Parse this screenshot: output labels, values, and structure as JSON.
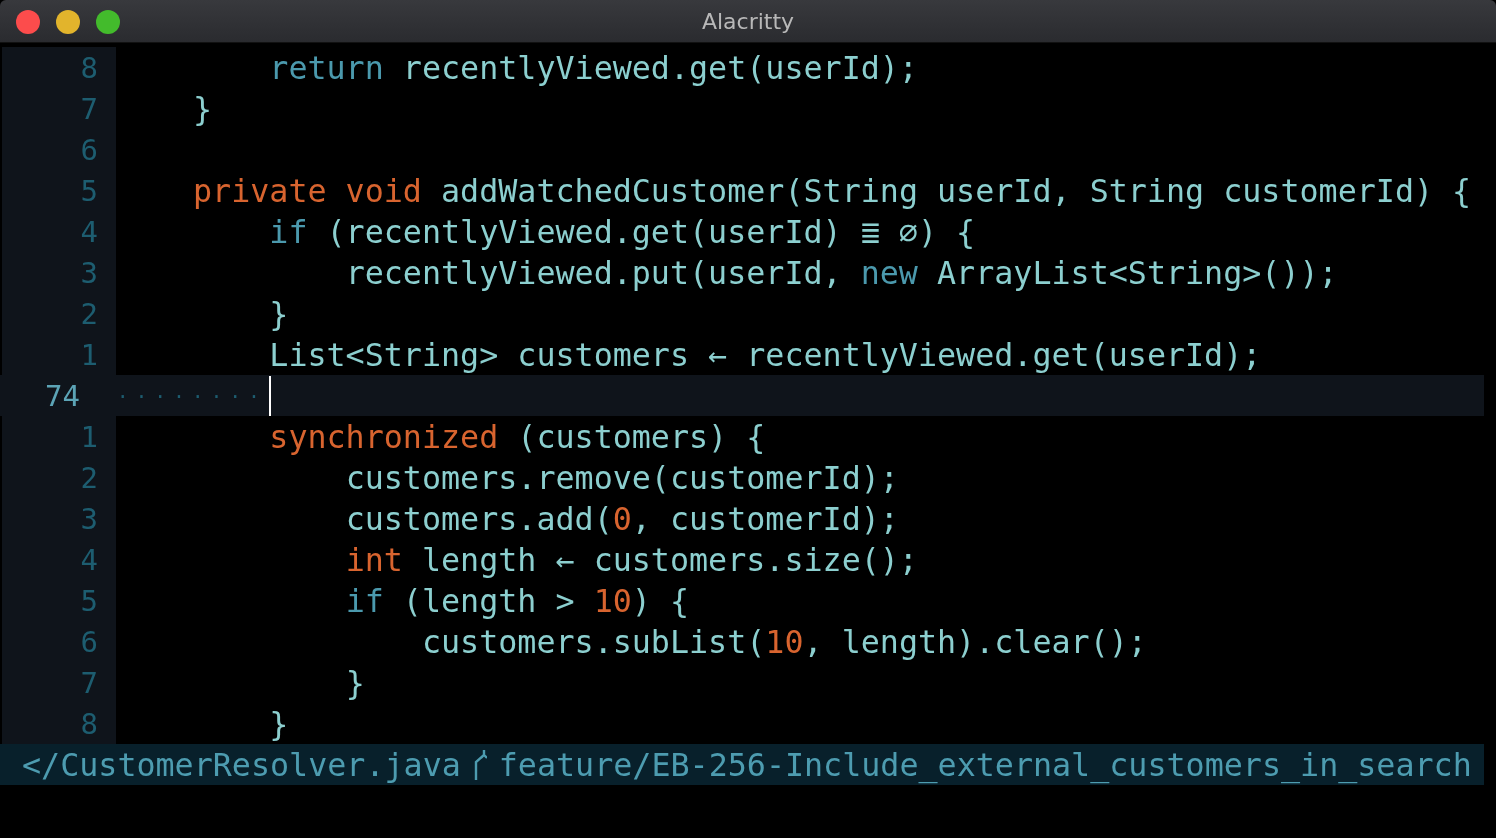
{
  "window": {
    "title": "Alacritty"
  },
  "lines": [
    {
      "number": "8",
      "current": false,
      "segments": [
        {
          "kind": "control",
          "text": "    return"
        },
        {
          "kind": "plain",
          "text": " recentlyViewed.get(userId);"
        }
      ]
    },
    {
      "number": "7",
      "current": false,
      "segments": [
        {
          "kind": "plain",
          "text": "}"
        }
      ]
    },
    {
      "number": "6",
      "current": false
    },
    {
      "number": "5",
      "current": false,
      "segments": [
        {
          "kind": "keyword",
          "text": "private void"
        },
        {
          "kind": "plain",
          "text": " addWatchedCustomer(String userId, String customerId) {"
        }
      ]
    },
    {
      "number": "4",
      "current": false,
      "segments": [
        {
          "kind": "control",
          "text": "    if"
        },
        {
          "kind": "plain",
          "text": " (recentlyViewed.get(userId) ≣ ∅) {"
        }
      ]
    },
    {
      "number": "3",
      "current": false,
      "segments": [
        {
          "kind": "plain",
          "text": "        recentlyViewed.put(userId, "
        },
        {
          "kind": "control",
          "text": "new"
        },
        {
          "kind": "plain",
          "text": " ArrayList<String>());"
        }
      ]
    },
    {
      "number": "2",
      "current": false,
      "segments": [
        {
          "kind": "plain",
          "text": "    }"
        }
      ]
    },
    {
      "number": "1",
      "current": false,
      "segments": [
        {
          "kind": "plain",
          "text": "    List<String> customers ← recentlyViewed.get(userId);"
        }
      ]
    },
    {
      "number": "74",
      "current": true,
      "cursor": true,
      "segments": [
        {
          "kind": "whitespace",
          "text": "········"
        }
      ]
    },
    {
      "number": "1",
      "current": false,
      "segments": [
        {
          "kind": "keyword",
          "text": "    synchronized"
        },
        {
          "kind": "plain",
          "text": " (customers) {"
        }
      ]
    },
    {
      "number": "2",
      "current": false,
      "segments": [
        {
          "kind": "plain",
          "text": "        customers.remove(customerId);"
        }
      ]
    },
    {
      "number": "3",
      "current": false,
      "segments": [
        {
          "kind": "plain",
          "text": "        customers.add("
        },
        {
          "kind": "number",
          "text": "0"
        },
        {
          "kind": "plain",
          "text": ", customerId);"
        }
      ]
    },
    {
      "number": "4",
      "current": false,
      "segments": [
        {
          "kind": "keyword",
          "text": "        int"
        },
        {
          "kind": "plain",
          "text": " length ← customers.size();"
        }
      ]
    },
    {
      "number": "5",
      "current": false,
      "segments": [
        {
          "kind": "control",
          "text": "        if"
        },
        {
          "kind": "plain",
          "text": " (length > "
        },
        {
          "kind": "number",
          "text": "10"
        },
        {
          "kind": "plain",
          "text": ") {"
        }
      ]
    },
    {
      "number": "6",
      "current": false,
      "segments": [
        {
          "kind": "plain",
          "text": "            customers.subList("
        },
        {
          "kind": "number",
          "text": "10"
        },
        {
          "kind": "plain",
          "text": ", length).clear();"
        }
      ]
    },
    {
      "number": "7",
      "current": false,
      "segments": [
        {
          "kind": "plain",
          "text": "        }"
        }
      ]
    },
    {
      "number": "8",
      "current": false,
      "segments": [
        {
          "kind": "plain",
          "text": "    }"
        }
      ]
    }
  ],
  "status_bar": {
    "file": "</CustomerResolver.java",
    "branch": "feature/EB-256-Include_external_customers_in_search"
  }
}
